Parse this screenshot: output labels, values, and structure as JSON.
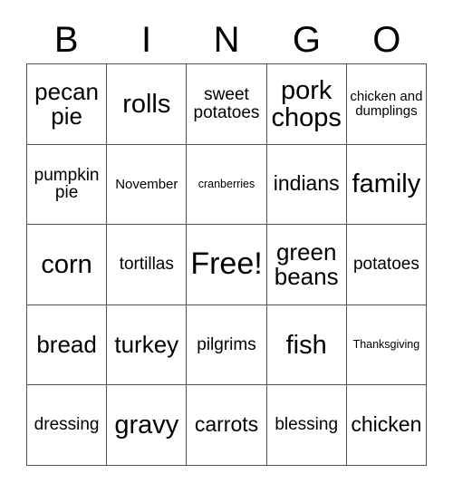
{
  "card": {
    "title": "BINGO",
    "header_letters": [
      "B",
      "I",
      "N",
      "G",
      "O"
    ],
    "grid_size": "5x5",
    "free_space_label": "Free!",
    "colors": {
      "background": "#ffffff",
      "text": "#000000",
      "border": "#555555"
    }
  },
  "rows": [
    {
      "cells": [
        {
          "text": "pecan pie",
          "size": "lg"
        },
        {
          "text": "rolls",
          "size": "xl"
        },
        {
          "text": "sweet potatoes",
          "size": "sm"
        },
        {
          "text": "pork chops",
          "size": "xl"
        },
        {
          "text": "chicken and dumplings",
          "size": "xs"
        }
      ]
    },
    {
      "cells": [
        {
          "text": "pumpkin pie",
          "size": "sm"
        },
        {
          "text": "November",
          "size": "xs"
        },
        {
          "text": "cranberries",
          "size": "xxs"
        },
        {
          "text": "indians",
          "size": "md"
        },
        {
          "text": "family",
          "size": "xl"
        }
      ]
    },
    {
      "cells": [
        {
          "text": "corn",
          "size": "xl"
        },
        {
          "text": "tortillas",
          "size": "sm"
        },
        {
          "text": "Free!",
          "size": "xxl"
        },
        {
          "text": "green beans",
          "size": "lg"
        },
        {
          "text": "potatoes",
          "size": "sm"
        }
      ]
    },
    {
      "cells": [
        {
          "text": "bread",
          "size": "lg"
        },
        {
          "text": "turkey",
          "size": "lg"
        },
        {
          "text": "pilgrims",
          "size": "sm"
        },
        {
          "text": "fish",
          "size": "xl"
        },
        {
          "text": "Thanksgiving",
          "size": "xxs"
        }
      ]
    },
    {
      "cells": [
        {
          "text": "dressing",
          "size": "sm"
        },
        {
          "text": "gravy",
          "size": "xl"
        },
        {
          "text": "carrots",
          "size": "md"
        },
        {
          "text": "blessing",
          "size": "sm"
        },
        {
          "text": "chicken",
          "size": "md"
        }
      ]
    }
  ]
}
